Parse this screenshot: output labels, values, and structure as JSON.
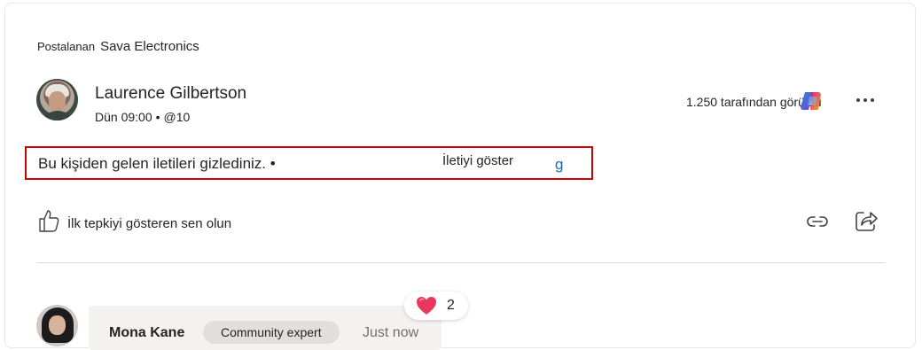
{
  "post": {
    "posted_label": "Postalanan",
    "community": "Sava Electronics",
    "author": "Laurence Gilbertson",
    "time": "Dün 09:00",
    "separator": "•",
    "mention": "@10",
    "views": "1.250 tarafından görüldü",
    "hidden_text": "Bu kişiden gelen iletileri gizlediniz. •",
    "show_link": "İletiyi göster",
    "like_prompt": "İlk tepkiyi gösteren sen olun"
  },
  "reply": {
    "author": "Mona Kane",
    "badge": "Community expert",
    "time": "Just now",
    "reaction_count": "2"
  },
  "icons": {
    "avatar": "author-avatar",
    "copilot": "copilot-icon",
    "more": "more-options-icon",
    "like": "thumbs-up-icon",
    "link": "link-icon",
    "share": "share-icon",
    "heart": "heart-icon"
  },
  "colors": {
    "highlight_border": "#d10000",
    "link_blue": "#0f6cbd",
    "heart": "#e8385d"
  }
}
